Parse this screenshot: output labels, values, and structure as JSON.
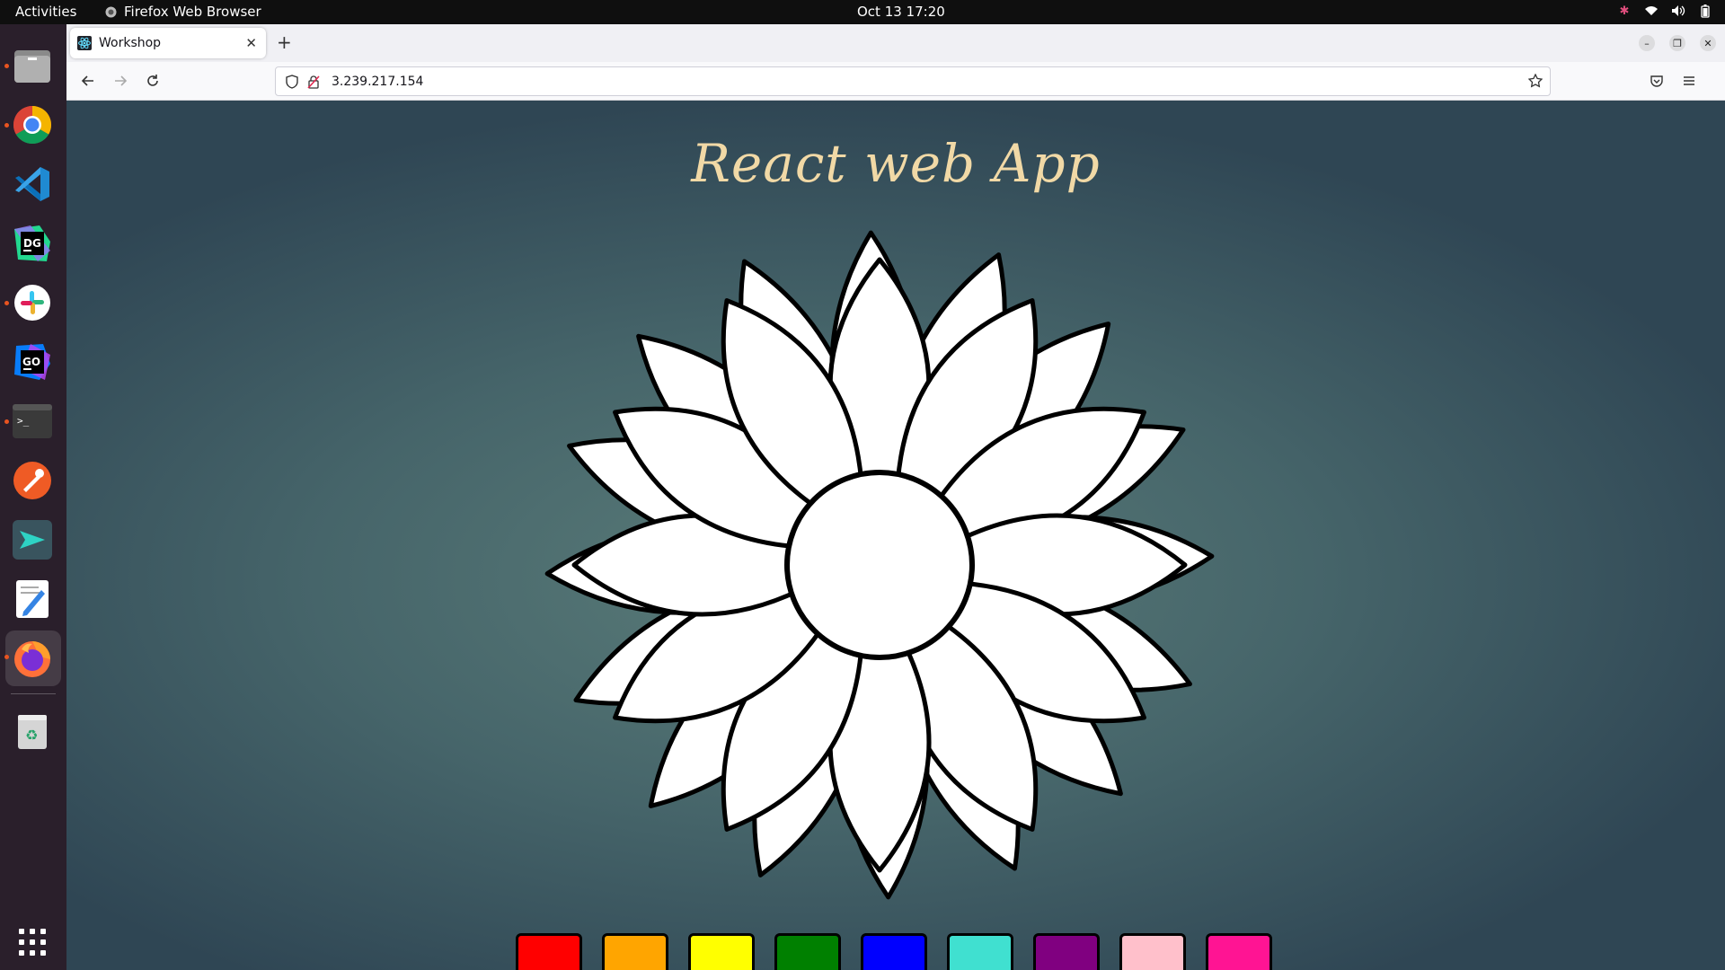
{
  "topbar": {
    "activities": "Activities",
    "app_name": "Firefox Web Browser",
    "clock": "Oct 13  17:20"
  },
  "dock": {
    "apps": [
      {
        "name": "files-icon",
        "running": true
      },
      {
        "name": "chrome-icon",
        "running": true
      },
      {
        "name": "vscode-icon",
        "running": false
      },
      {
        "name": "datagrip-icon",
        "running": false
      },
      {
        "name": "slack-icon",
        "running": true
      },
      {
        "name": "goland-icon",
        "running": false
      },
      {
        "name": "terminal-icon",
        "running": true
      },
      {
        "name": "postman-icon",
        "running": false
      },
      {
        "name": "remote-desktop-icon",
        "running": false
      },
      {
        "name": "text-editor-icon",
        "running": false
      },
      {
        "name": "firefox-icon",
        "running": true
      },
      {
        "name": "trash-icon",
        "running": false
      }
    ]
  },
  "browser": {
    "tab_title": "Workshop",
    "url": "3.239.217.154"
  },
  "page": {
    "title": "React web App",
    "swatches": [
      "#ff0000",
      "#ffa500",
      "#ffff00",
      "#008000",
      "#0000ff",
      "#40e0d0",
      "#800080",
      "#ffc0cb",
      "#ff1493"
    ]
  },
  "colors": {
    "flower_fill": "#ffffff",
    "flower_stroke": "#000000",
    "title_color": "#f1d9a6"
  }
}
